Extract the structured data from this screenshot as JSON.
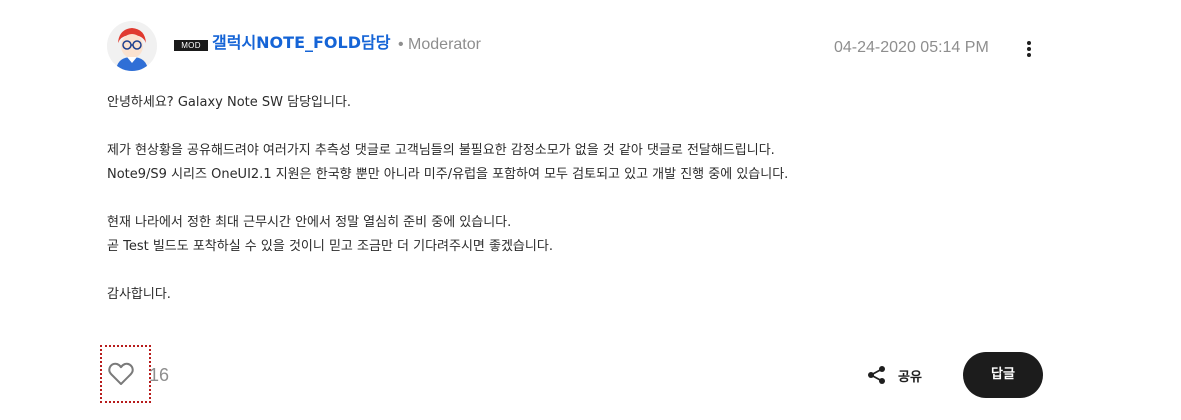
{
  "author": {
    "badge": "MOD",
    "name": "갤럭시NOTE_FOLD담당",
    "role": "• Moderator"
  },
  "post": {
    "timestamp": "04-24-2020 05:14 PM",
    "lines": [
      "안녕하세요? Galaxy Note SW 담당입니다.",
      "",
      "제가 현상황을 공유해드려야 여러가지 추측성 댓글로 고객님들의 불필요한 감정소모가 없을 것 같아 댓글로 전달해드립니다.",
      "Note9/S9 시리즈 OneUI2.1 지원은 한국향 뿐만 아니라 미주/유럽을 포함하여 모두 검토되고 있고 개발 진행 중에 있습니다.",
      "",
      "현재 나라에서 정한 최대 근무시간 안에서 정말 열심히 준비 중에 있습니다.",
      "곧 Test 빌드도 포착하실 수 있을 것이니 믿고 조금만 더 기다려주시면 좋겠습니다.",
      "",
      "감사합니다."
    ]
  },
  "actions": {
    "like_count": "16",
    "share_label": "공유",
    "reply_label": "답글"
  },
  "icons": {
    "avatar": "avatar-illustration",
    "more": "more-vertical-icon",
    "like": "heart-outline-icon",
    "share": "share-icon"
  },
  "colors": {
    "author_name": "#1564d6",
    "muted_text": "#8e8e8e",
    "reply_button_bg": "#1c1c1c",
    "focus_outline": "#b71c1c"
  }
}
